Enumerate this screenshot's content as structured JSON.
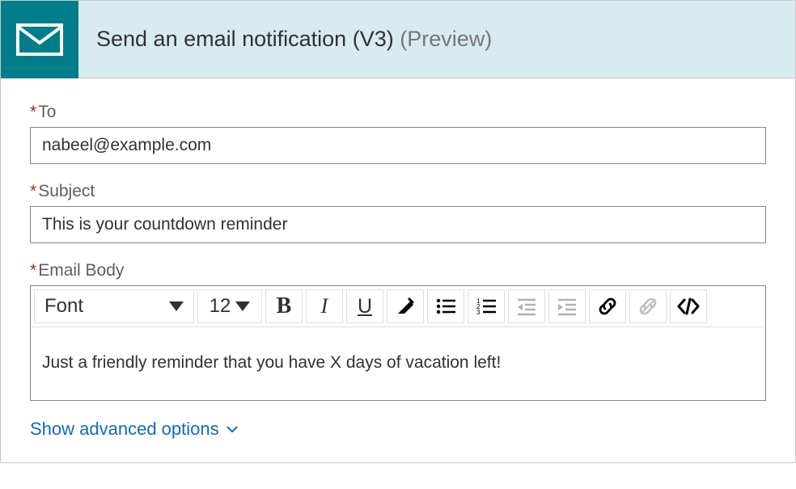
{
  "header": {
    "title": "Send an email notification (V3)",
    "suffix": "(Preview)"
  },
  "fields": {
    "to": {
      "label": "To",
      "value": "nabeel@example.com"
    },
    "subject": {
      "label": "Subject",
      "value": "This is your countdown reminder"
    },
    "body": {
      "label": "Email Body",
      "value": "Just a friendly reminder that you have X days of vacation left!"
    }
  },
  "toolbar": {
    "font_label": "Font",
    "font_size": "12",
    "bold": "B",
    "italic": "I",
    "underline": "U"
  },
  "advanced": {
    "label": "Show advanced options"
  }
}
